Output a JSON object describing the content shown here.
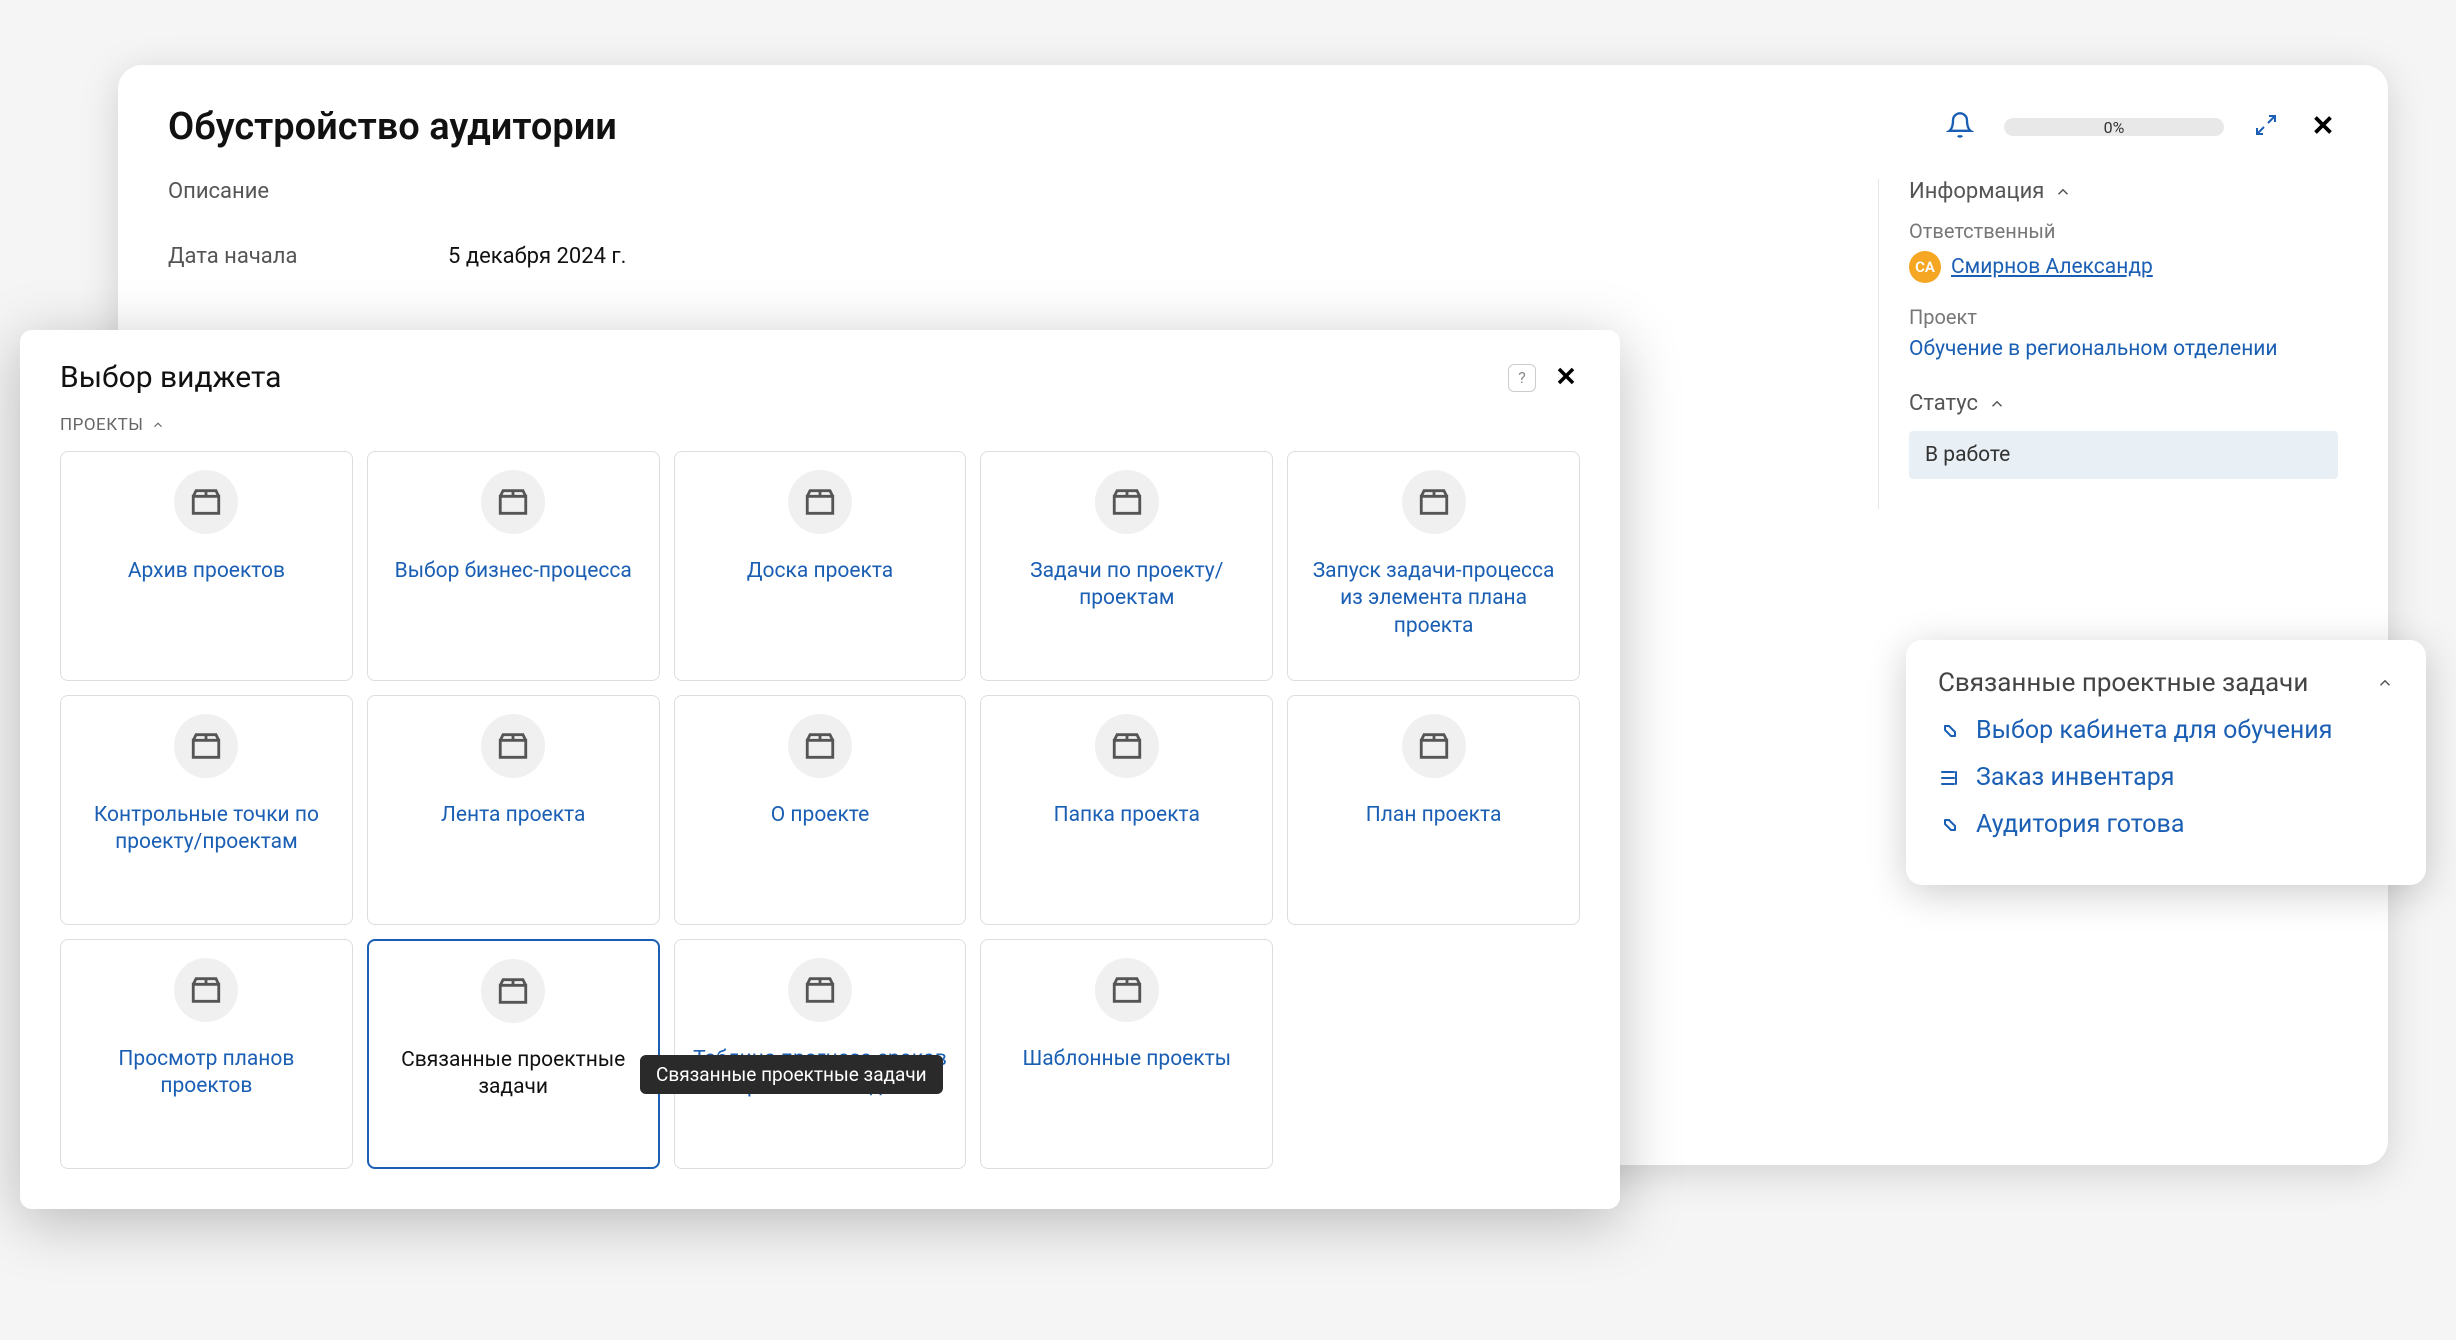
{
  "task": {
    "title": "Обустройство аудитории",
    "desc_label": "Описание",
    "start_label": "Дата начала",
    "start_value": "5 декабря 2024 г.",
    "progress_text": "0%"
  },
  "sidebar": {
    "info_header": "Информация",
    "responsible_label": "Ответственный",
    "responsible_initials": "СА",
    "responsible_name": "Смирнов Александр",
    "project_label": "Проект",
    "project_name": "Обучение в региональном отделении",
    "status_header": "Статус",
    "status_value": "В работе"
  },
  "related": {
    "header": "Связанные проектные задачи",
    "items": [
      "Выбор кабинета для обучения",
      "Заказ инвентаря",
      "Аудитория готова"
    ]
  },
  "dialog": {
    "title": "Выбор виджета",
    "group_label": "ПРОЕКТЫ",
    "help_glyph": "?",
    "widgets": [
      "Архив проектов",
      "Выбор бизнес-процесса",
      "Доска проекта",
      "Задачи по проекту/проектам",
      "Запуск задачи-процесса из элемента плана проекта",
      "Контрольные точки по проекту/проектам",
      "Лента проекта",
      "О проекте",
      "Папка проекта",
      "План проекта",
      "Просмотр планов проектов",
      "Связанные проектные задачи",
      "Таблица прогноза сроков проектных задач",
      "Шаблонные проекты"
    ],
    "tooltip": "Связанные проектные задачи"
  }
}
